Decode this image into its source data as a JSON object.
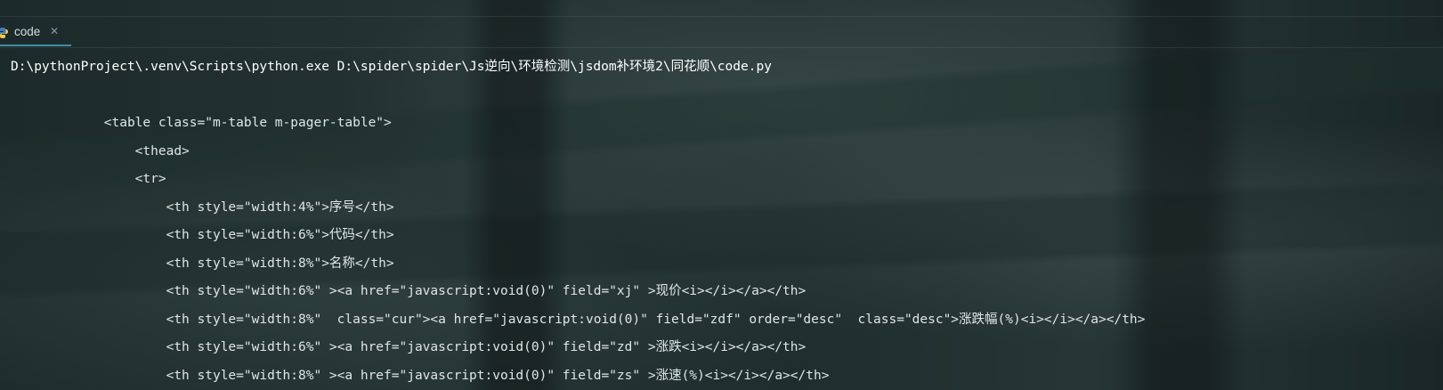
{
  "tab": {
    "label": "code",
    "icon": "python-icon",
    "close_icon": "close-icon"
  },
  "console": {
    "lines": [
      {
        "indent": "",
        "text": "D:\\pythonProject\\.venv\\Scripts\\python.exe D:\\spider\\spider\\Js逆向\\环境检测\\jsdom补环境2\\同花顺\\code.py"
      },
      {
        "indent": "",
        "text": ""
      },
      {
        "indent": "            ",
        "text": "<table class=\"m-table m-pager-table\">"
      },
      {
        "indent": "                ",
        "text": "<thead>"
      },
      {
        "indent": "                ",
        "text": "<tr>"
      },
      {
        "indent": "                    ",
        "text": "<th style=\"width:4%\">序号</th>"
      },
      {
        "indent": "                    ",
        "text": "<th style=\"width:6%\">代码</th>"
      },
      {
        "indent": "                    ",
        "text": "<th style=\"width:8%\">名称</th>"
      },
      {
        "indent": "                    ",
        "text": "<th style=\"width:6%\" ><a href=\"javascript:void(0)\" field=\"xj\" >现价<i></i></a></th>"
      },
      {
        "indent": "                    ",
        "text": "<th style=\"width:8%\"  class=\"cur\"><a href=\"javascript:void(0)\" field=\"zdf\" order=\"desc\"  class=\"desc\">涨跌幅(%)<i></i></a></th>"
      },
      {
        "indent": "                    ",
        "text": "<th style=\"width:6%\" ><a href=\"javascript:void(0)\" field=\"zd\" >涨跌<i></i></a></th>"
      },
      {
        "indent": "                    ",
        "text": "<th style=\"width:8%\" ><a href=\"javascript:void(0)\" field=\"zs\" >涨速(%)<i></i></a></th>"
      }
    ]
  }
}
